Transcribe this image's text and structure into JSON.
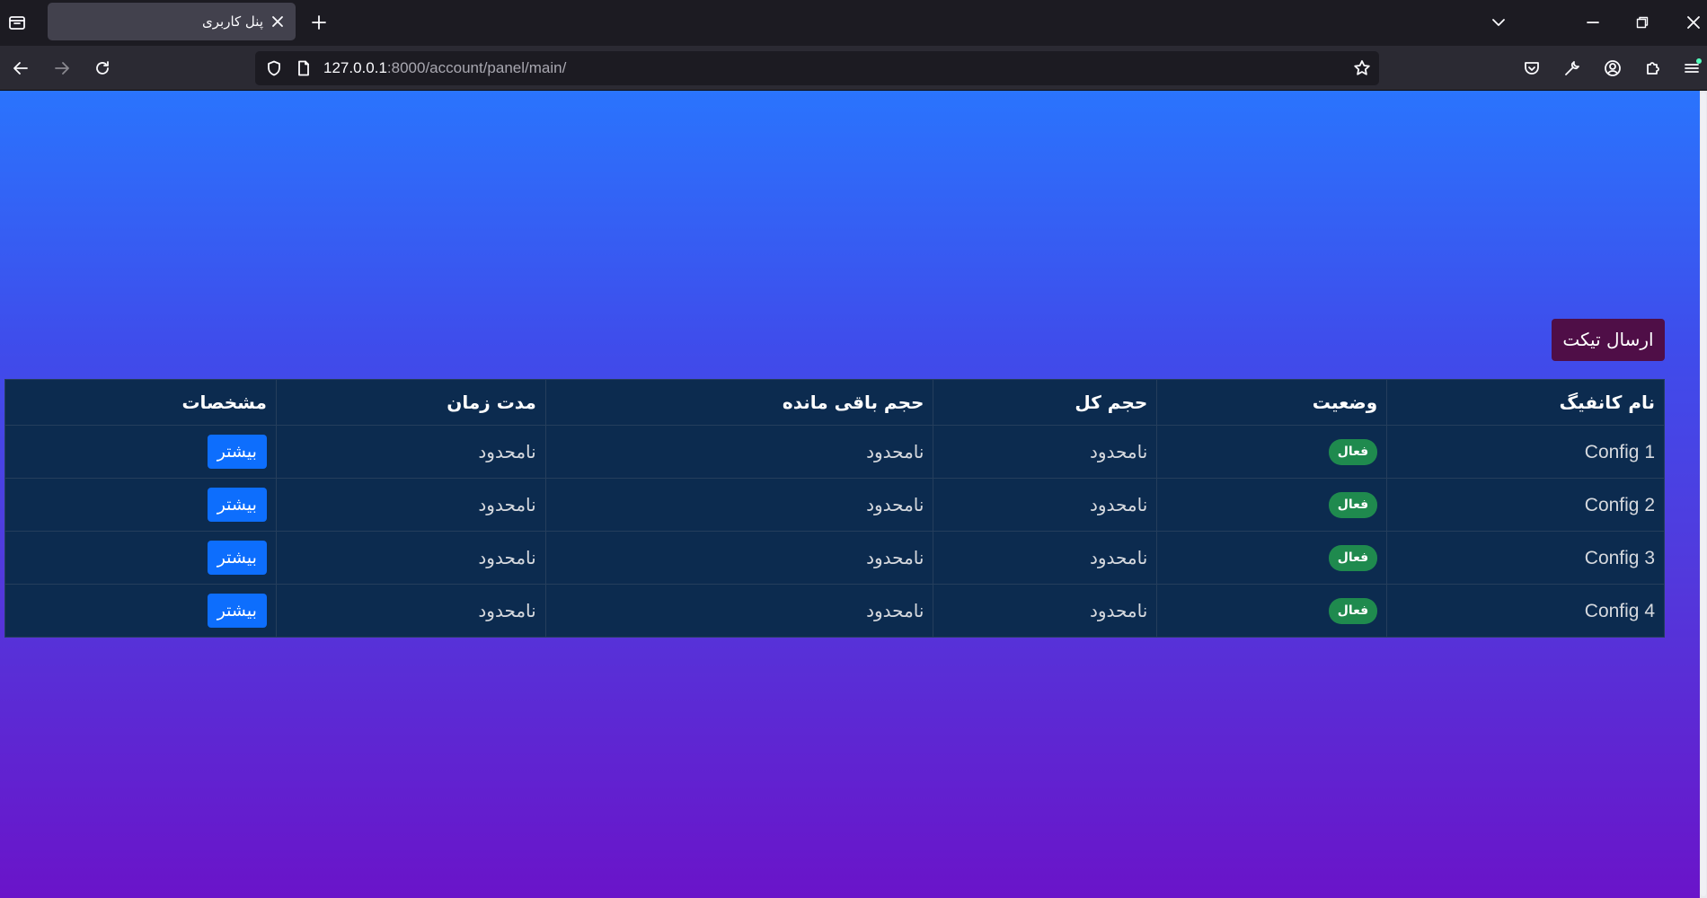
{
  "browser": {
    "tab_title": "پنل کاربری",
    "url_host": "127.0.0.1",
    "url_path": ":8000/account/panel/main/"
  },
  "page": {
    "ticket_button": "ارسال تیکت",
    "table": {
      "headers": [
        "نام کانفیگ",
        "وضعیت",
        "حجم کل",
        "حجم باقی مانده",
        "مدت زمان",
        "مشخصات"
      ],
      "rows": [
        {
          "name": "Config 1",
          "status": "فعال",
          "total": "نامحدود",
          "remaining": "نامحدود",
          "duration": "نامحدود",
          "action": "بیشتر"
        },
        {
          "name": "Config 2",
          "status": "فعال",
          "total": "نامحدود",
          "remaining": "نامحدود",
          "duration": "نامحدود",
          "action": "بیشتر"
        },
        {
          "name": "Config 3",
          "status": "فعال",
          "total": "نامحدود",
          "remaining": "نامحدود",
          "duration": "نامحدود",
          "action": "بیشتر"
        },
        {
          "name": "Config 4",
          "status": "فعال",
          "total": "نامحدود",
          "remaining": "نامحدود",
          "duration": "نامحدود",
          "action": "بیشتر"
        }
      ]
    }
  },
  "colors": {
    "gradient_top": "#2a74fd",
    "gradient_bottom": "#6a14c9",
    "table_bg": "#0c2b4f",
    "badge_green": "#1f8a4e",
    "button_blue": "#0d6efd",
    "ticket_button": "#4f0e47"
  }
}
